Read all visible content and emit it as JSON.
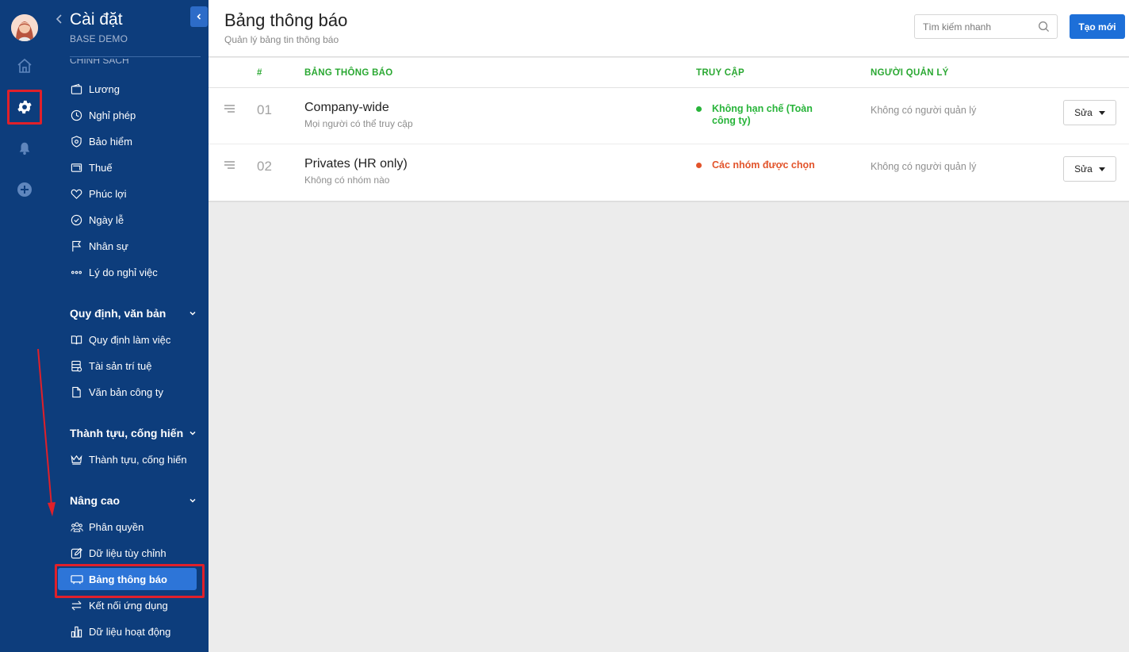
{
  "rail": {
    "icons": [
      "avatar",
      "home-icon",
      "gear-icon",
      "bell-icon",
      "plus-circle-icon"
    ]
  },
  "sidebar": {
    "title": "Cài đặt",
    "subtitle": "BASE DEMO",
    "cut_heading": "CHÍNH SÁCH",
    "policy_items": [
      {
        "label": "Lương",
        "icon": "wallet-icon"
      },
      {
        "label": "Nghỉ phép",
        "icon": "clock-icon"
      },
      {
        "label": "Bảo hiểm",
        "icon": "shield-icon"
      },
      {
        "label": "Thuế",
        "icon": "card-icon"
      },
      {
        "label": "Phúc lợi",
        "icon": "heart-icon"
      },
      {
        "label": "Ngày lễ",
        "icon": "check-circle-icon"
      },
      {
        "label": "Nhân sự",
        "icon": "flag-icon"
      },
      {
        "label": "Lý do nghỉ việc",
        "icon": "dots-icon"
      }
    ],
    "group_rules": "Quy định, văn bản",
    "rules_items": [
      {
        "label": "Quy định làm việc",
        "icon": "book-icon"
      },
      {
        "label": "Tài sản trí tuệ",
        "icon": "database-icon"
      },
      {
        "label": "Văn bản công ty",
        "icon": "document-icon"
      }
    ],
    "group_achievements": "Thành tựu, cống hiến",
    "achievement_items": [
      {
        "label": "Thành tựu, cống hiến",
        "icon": "crown-icon"
      }
    ],
    "group_advanced": "Nâng cao",
    "advanced_items": [
      {
        "label": "Phân quyền",
        "icon": "users-icon"
      },
      {
        "label": "Dữ liệu tùy chỉnh",
        "icon": "edit-icon"
      },
      {
        "label": "Bảng thông báo",
        "icon": "monitor-icon",
        "active": true
      },
      {
        "label": "Kết nối ứng dụng",
        "icon": "swap-icon"
      },
      {
        "label": "Dữ liệu hoạt động",
        "icon": "bar-chart-icon"
      }
    ]
  },
  "header": {
    "title": "Bảng thông báo",
    "subtitle": "Quản lý bảng tin thông báo",
    "search_placeholder": "Tìm kiếm nhanh",
    "create_label": "Tạo mới"
  },
  "table": {
    "columns": [
      "#",
      "BẢNG THÔNG BÁO",
      "TRUY CẬP",
      "NGƯỜI QUẢN LÝ"
    ],
    "rows": [
      {
        "num": "01",
        "name": "Company-wide",
        "desc": "Mọi người có thể truy cập",
        "access": "Không hạn chế (Toàn công ty)",
        "access_color": "#28b43a",
        "manager": "Không có người quản lý",
        "action": "Sửa"
      },
      {
        "num": "02",
        "name": "Privates (HR only)",
        "desc": "Không có nhóm nào",
        "access": "Các nhóm được chọn",
        "access_color": "#e2542b",
        "manager": "Không có người quản lý",
        "action": "Sửa"
      }
    ]
  },
  "colors": {
    "sidebar_bg": "#0d3d7c",
    "active_bg": "#2d75d8",
    "primary": "#1d6fd8",
    "header_green": "#2aa832",
    "highlight_red": "#e0202a"
  }
}
